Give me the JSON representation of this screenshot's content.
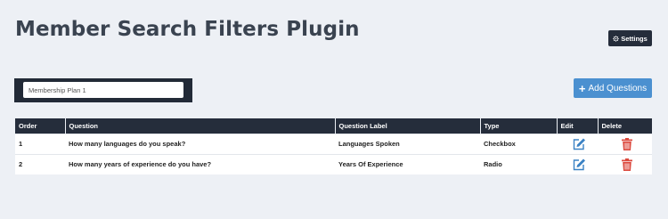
{
  "page": {
    "title": "Member Search Filters Plugin"
  },
  "toolbar": {
    "settings_label": "Settings",
    "settings_icon": "gear-icon",
    "add_label": "Add Questions",
    "add_icon": "plus-icon"
  },
  "plan": {
    "selected": "Membership Plan 1"
  },
  "table": {
    "headers": {
      "order": "Order",
      "question": "Question",
      "label": "Question Label",
      "type": "Type",
      "edit": "Edit",
      "delete": "Delete"
    },
    "rows": [
      {
        "order": "1",
        "question": "How many languages do you speak?",
        "label": "Languages Spoken",
        "type": "Checkbox",
        "edit_icon": "edit-icon",
        "delete_icon": "trash-icon"
      },
      {
        "order": "2",
        "question": "How many years of experience do you have?",
        "label": "Years Of Experience",
        "type": "Radio",
        "edit_icon": "edit-icon",
        "delete_icon": "trash-icon"
      }
    ]
  },
  "colors": {
    "background": "#edf0f5",
    "dark": "#252d3b",
    "primary": "#4b90d0",
    "edit_icon": "#3b82c4",
    "delete_icon": "#dc4a3f"
  }
}
